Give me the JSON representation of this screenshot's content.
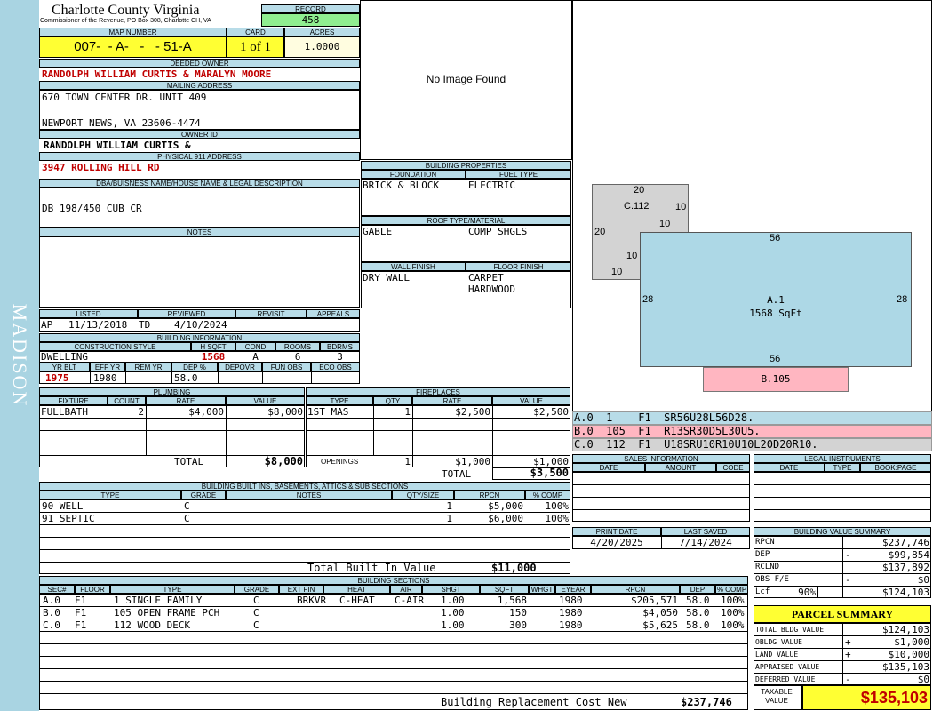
{
  "county": {
    "name": "Charlotte County Virginia",
    "address": "Commissioner of the Revenue, PO Box 308, Charlotte CH, VA"
  },
  "sidebar": {
    "district": "MADISON"
  },
  "labels": {
    "record": "RECORD",
    "map_number": "MAP NUMBER",
    "card": "CARD",
    "acres": "ACRES",
    "deeded_owner": "DEEDED OWNER",
    "mailing_address": "MAILING ADDRESS",
    "owner_id": "OWNER ID",
    "physical": "PHYSICAL 911 ADDRESS",
    "dba": "DBA/BUISNESS NAME/HOUSE NAME & LEGAL DESCRIPTION",
    "notes": "NOTES",
    "listed": "LISTED",
    "reviewed": "REVIEWED",
    "revisit": "REVISIT",
    "appeals": "APPEALS",
    "building_info": "BUILDING INFORMATION",
    "construction_style": "CONSTRUCTION STYLE",
    "hsqft": "H SQFT",
    "cond": "COND",
    "rooms": "ROOMS",
    "bdrms": "BDRMS",
    "yr_blt": "YR BLT",
    "eff_yr": "EFF YR",
    "rem_yr": "REM YR",
    "dep_pct": "DEP %",
    "depovr": "DEPOVR",
    "fun_obs": "FUN OBS",
    "eco_obs": "ECO OBS",
    "plumbing": "PLUMBING",
    "fixture": "FIXTURE",
    "count": "COUNT",
    "rate": "RATE",
    "value": "VALUE",
    "total": "TOTAL",
    "fireplaces": "FIREPLACES",
    "type": "TYPE",
    "qty": "QTY",
    "openings": "OPENINGS",
    "built_ins": "BUILDING BUILT INS, BASEMENTS, ATTICS & SUB SECTIONS",
    "grade": "GRADE",
    "bi_notes": "NOTES",
    "qty_size": "QTY/SIZE",
    "rpcn": "RPCN",
    "pct_comp": "% COMP",
    "total_built_in": "Total Built In Value",
    "building_sections": "BUILDING SECTIONS",
    "bs_sec": "SEC#",
    "bs_floor": "FLOOR",
    "bs_type": "TYPE",
    "bs_grade": "GRADE",
    "bs_ext": "EXT FIN",
    "bs_heat": "HEAT",
    "bs_air": "AIR",
    "bs_shgt": "SHGT",
    "bs_sqft": "SQFT",
    "bs_whgt": "WHGT",
    "bs_eyear": "EYEAR",
    "bs_rpcn": "RPCN",
    "bs_dep": "DEP",
    "bs_comp": "% COMP",
    "brcn": "Building Replacement Cost New",
    "building_properties": "BUILDING PROPERTIES",
    "foundation": "FOUNDATION",
    "fuel_type": "FUEL TYPE",
    "roof": "ROOF TYPE/MATERIAL",
    "wall_finish": "WALL FINISH",
    "floor_finish": "FLOOR FINISH",
    "sales_info": "SALES INFORMATION",
    "date": "DATE",
    "amount": "AMOUNT",
    "code": "CODE",
    "legal_instruments": "LEGAL INSTRUMENTS",
    "li_date": "DATE",
    "li_type": "TYPE",
    "bookpage": "BOOK:PAGE",
    "print_date": "PRINT DATE",
    "last_saved": "LAST SAVED",
    "bvs": "BUILDING VALUE SUMMARY",
    "parcel_summary": "PARCEL SUMMARY",
    "taxable": "TAXABLE VALUE"
  },
  "record": "458",
  "map_number": "007-  - A-   -   - 51-A",
  "card": "1 of 1",
  "acres": "1.0000",
  "deeded_owner": "RANDOLPH WILLIAM CURTIS & MARALYN MOORE",
  "mailing": {
    "line1": "670 TOWN CENTER DR. UNIT 409",
    "line2": "NEWPORT NEWS, VA 23606-4474"
  },
  "owner_id": "RANDOLPH WILLIAM CURTIS &",
  "physical_address": "3947 ROLLING HILL RD",
  "legal_description": "DB 198/450 CUB CR",
  "image_placeholder": "No Image Found",
  "listed": {
    "code": "AP",
    "date": "11/13/2018",
    "by": "TD"
  },
  "reviewed": "4/10/2024",
  "building_info": {
    "style": "DWELLING",
    "hsqft": "1568",
    "cond": "A",
    "rooms": "6",
    "bdrms": "3",
    "yr_blt": "1975",
    "eff_yr": "1980",
    "dep_pct": "58.0"
  },
  "plumbing": {
    "rows": [
      {
        "fixture": "FULLBATH",
        "count": "2",
        "rate": "$4,000",
        "value": "$8,000"
      }
    ],
    "total": "$8,000"
  },
  "fireplaces": {
    "rows": [
      {
        "type": "1ST MAS",
        "qty": "1",
        "rate": "$2,500",
        "value": "$2,500"
      }
    ],
    "openings": {
      "qty": "1",
      "rate": "$1,000",
      "value": "$1,000"
    },
    "total": "$3,500"
  },
  "built_ins": {
    "rows": [
      {
        "type": "90 WELL",
        "grade": "C",
        "qty": "1",
        "rpcn": "$5,000",
        "comp": "100%"
      },
      {
        "type": "91 SEPTIC",
        "grade": "C",
        "qty": "1",
        "rpcn": "$6,000",
        "comp": "100%"
      }
    ],
    "total": "$11,000"
  },
  "sections": {
    "rows": [
      {
        "sec": "A.0",
        "floor": "F1",
        "type": "1 SINGLE FAMILY",
        "grade": "C",
        "ext": "BRKVR",
        "heat": "C-HEAT",
        "air": "C-AIR",
        "shgt": "1.00",
        "sqft": "1,568",
        "eyear": "1980",
        "rpcn": "$205,571",
        "dep": "58.0",
        "comp": "100%"
      },
      {
        "sec": "B.0",
        "floor": "F1",
        "type": "105 OPEN FRAME PCH",
        "grade": "C",
        "ext": "",
        "heat": "",
        "air": "",
        "shgt": "1.00",
        "sqft": "150",
        "eyear": "1980",
        "rpcn": "$4,050",
        "dep": "58.0",
        "comp": "100%"
      },
      {
        "sec": "C.0",
        "floor": "F1",
        "type": "112 WOOD DECK",
        "grade": "C",
        "ext": "",
        "heat": "",
        "air": "",
        "shgt": "1.00",
        "sqft": "300",
        "eyear": "1980",
        "rpcn": "$5,625",
        "dep": "58.0",
        "comp": "100%"
      }
    ],
    "brcn": "$237,746"
  },
  "properties": {
    "foundation": "BRICK & BLOCK",
    "fuel": "ELECTRIC",
    "roof1": "GABLE",
    "roof2": "COMP SHGLS",
    "wall": "DRY WALL",
    "floor1": "CARPET",
    "floor2": "HARDWOOD"
  },
  "sketch": {
    "c_label": "C.112",
    "c_top": "20",
    "c_left": "20",
    "c_r1": "10",
    "c_r2": "10",
    "c_b1": "10",
    "c_b2": "10",
    "a_label": "A.1",
    "a_area": "1568 SqFt",
    "a_top": "56",
    "a_bottom": "56",
    "a_left": "28",
    "a_right": "28",
    "b_label": "B.105"
  },
  "sketch_codes": [
    {
      "text": "A.0  1    F1  SR56U28L56D28.",
      "color": "#b8dce8"
    },
    {
      "text": "B.0  105  F1  R13SR30D5L30U5.",
      "color": "#ffb6c1"
    },
    {
      "text": "C.0  112  F1  U18SRU10R10U10L20D20R10.",
      "color": "#d3d3d3"
    }
  ],
  "print_date": "4/20/2025",
  "last_saved": "7/14/2024",
  "bvs": [
    {
      "label": "RPCN",
      "sign": "",
      "value": "$237,746"
    },
    {
      "label": "DEP",
      "sign": "-",
      "value": "$99,854"
    },
    {
      "label": "RCLND",
      "sign": "",
      "value": "$137,892"
    },
    {
      "label": "OBS F/E",
      "sign": "-",
      "value": "$0"
    },
    {
      "label": "Lcf",
      "pct": "90%",
      "sign": "",
      "value": "$124,103"
    }
  ],
  "parcel": [
    {
      "label": "TOTAL BLDG VALUE",
      "sign": "",
      "value": "$124,103"
    },
    {
      "label": "OBLDG VALUE",
      "sign": "+",
      "value": "$1,000"
    },
    {
      "label": "LAND VALUE",
      "sign": "+",
      "value": "$10,000"
    },
    {
      "label": "APPRAISED VALUE",
      "sign": "",
      "value": "$135,103"
    },
    {
      "label": "DEFERRED VALUE",
      "sign": "-",
      "value": "$0"
    }
  ],
  "taxable_value": "$135,103"
}
